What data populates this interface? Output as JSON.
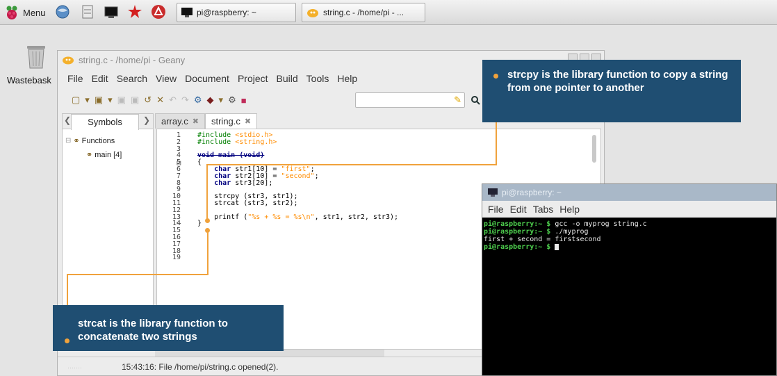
{
  "taskbar": {
    "menu_label": "Menu",
    "tasks": [
      {
        "label": "pi@raspberry: ~"
      },
      {
        "label": "string.c - /home/pi - ..."
      }
    ]
  },
  "desktop": {
    "wastebasket_label": "Wastebask"
  },
  "geany": {
    "title": "string.c - /home/pi - Geany",
    "menu": [
      "File",
      "Edit",
      "Search",
      "View",
      "Document",
      "Project",
      "Build",
      "Tools",
      "Help"
    ],
    "sidebar": {
      "tab_label": "Symbols",
      "functions_label": "Functions",
      "main_label": "main [4]"
    },
    "tabs": [
      {
        "label": "array.c",
        "active": false
      },
      {
        "label": "string.c",
        "active": true
      }
    ],
    "line_numbers": [
      "1",
      "2",
      "3",
      "4",
      "5",
      "6",
      "7",
      "8",
      "9",
      "10",
      "11",
      "12",
      "13",
      "14",
      "15",
      "16",
      "17",
      "18",
      "19"
    ],
    "code": {
      "l1_dir": "#include",
      "l1_arg": "<stdio.h>",
      "l2_dir": "#include",
      "l2_arg": "<string.h>",
      "l4": "void main (void)",
      "l5": "{",
      "l6_kw": "char",
      "l6_rest": " str1[10] = ",
      "l6_str": "\"first\"",
      "l6_end": ";",
      "l7_kw": "char",
      "l7_rest": " str2[10] = ",
      "l7_str": "\"second\"",
      "l7_end": ";",
      "l8_kw": "char",
      "l8_rest": " str3[20];",
      "l10": "strcpy (str3, str1);",
      "l11": "strcat (str3, str2);",
      "l13_a": "printf (",
      "l13_str": "\"%s + %s = %s\\n\"",
      "l13_b": ", str1, str2, str3);",
      "l14": "}"
    },
    "status": "15:43:16: File /home/pi/string.c opened(2)."
  },
  "terminal": {
    "title": "pi@raspberry: ~",
    "menu": [
      "File",
      "Edit",
      "Tabs",
      "Help"
    ],
    "lines": [
      {
        "prompt": "pi@raspberry:~ $ ",
        "text": "gcc -o myprog string.c"
      },
      {
        "prompt": "pi@raspberry:~ $ ",
        "text": "./myprog"
      },
      {
        "prompt": "",
        "text": "first + second = firstsecond"
      },
      {
        "prompt": "pi@raspberry:~ $ ",
        "text": ""
      }
    ]
  },
  "callouts": {
    "strcpy": "strcpy is the library function to copy a string from one pointer to another",
    "strcat": "strcat is the library function to concatenate two strings"
  },
  "colors": {
    "callout_bg": "#1f4e72",
    "callout_accent": "#f0a23c",
    "keyword": "#00007f",
    "preprocessor": "#007f00",
    "string": "#ff8c00",
    "prompt": "#4ed04e"
  }
}
